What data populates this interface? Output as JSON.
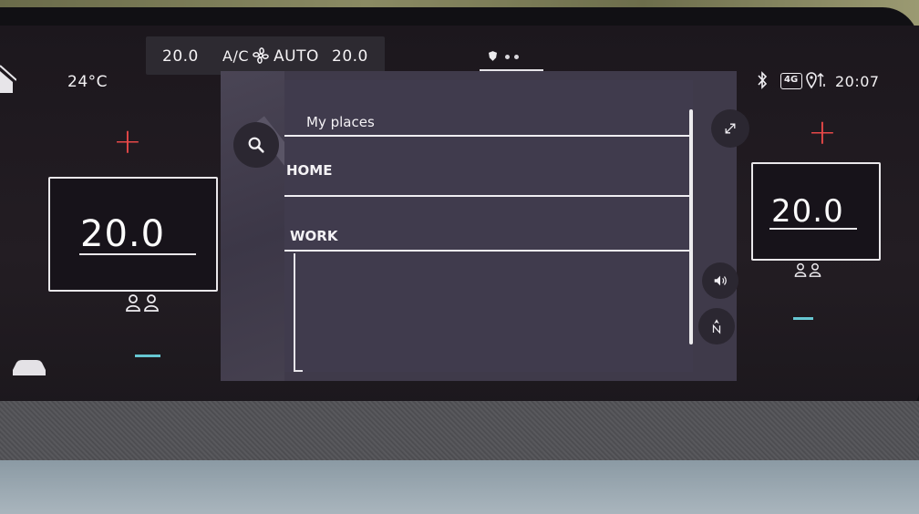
{
  "status_bar": {
    "outside_temp": "24°C",
    "left_temp": "20.0",
    "ac_label": "A/C",
    "auto_label": "AUTO",
    "right_temp": "20.0",
    "time": "20:07",
    "network": "4G"
  },
  "climate_left": {
    "temperature": "20.0"
  },
  "climate_right": {
    "temperature": "20.0"
  },
  "places_list": {
    "header": "My places",
    "items": [
      {
        "label": "HOME"
      },
      {
        "label": "WORK"
      }
    ]
  },
  "colors": {
    "plus_red": "#e84848",
    "minus_cyan": "#66c7d2",
    "panel_bg": "#403b4d"
  },
  "icons": {
    "search": "search-icon",
    "expand": "expand-icon",
    "volume": "volume-icon",
    "compass": "compass-north-icon",
    "bluetooth": "bluetooth-icon",
    "location": "location-pin-icon",
    "car": "car-icon",
    "home": "home-icon",
    "fan": "fan-icon",
    "seats": "seat-occupants-icon"
  }
}
